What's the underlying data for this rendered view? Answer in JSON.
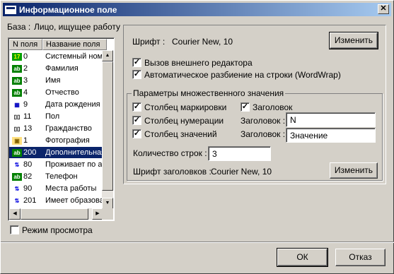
{
  "window": {
    "title": "Информационное поле",
    "close_glyph": "✕"
  },
  "base": {
    "label": "База :",
    "value": "Лицо, ищущее работу"
  },
  "fields_list": {
    "columns": [
      "N поля",
      "Название поля"
    ],
    "rows": [
      {
        "num": "0",
        "name": "Системный ном",
        "icon": "numeric-field-icon",
        "selected": false
      },
      {
        "num": "2",
        "name": "Фамилия",
        "icon": "text-field-icon",
        "selected": false
      },
      {
        "num": "3",
        "name": "Имя",
        "icon": "text-field-icon",
        "selected": false
      },
      {
        "num": "4",
        "name": "Отчество",
        "icon": "text-field-icon",
        "selected": false
      },
      {
        "num": "9",
        "name": "Дата рождения",
        "icon": "date-field-icon",
        "selected": false
      },
      {
        "num": "11",
        "name": "Пол",
        "icon": "dictionary-field-icon",
        "selected": false
      },
      {
        "num": "13",
        "name": "Гражданство",
        "icon": "dictionary-field-icon",
        "selected": false
      },
      {
        "num": "1",
        "name": "Фотография",
        "icon": "image-field-icon",
        "selected": false
      },
      {
        "num": "200",
        "name": "Дополнительная",
        "icon": "text-field-icon",
        "selected": true
      },
      {
        "num": "80",
        "name": "Проживает по а",
        "icon": "link-field-icon",
        "selected": false
      },
      {
        "num": "82",
        "name": "Телефон",
        "icon": "text-field-icon",
        "selected": false
      },
      {
        "num": "90",
        "name": "Места работы",
        "icon": "link-field-icon",
        "selected": false
      },
      {
        "num": "201",
        "name": "Имеет образова",
        "icon": "link-field-icon",
        "selected": false
      }
    ]
  },
  "view_mode": {
    "label": "Режим просмотра",
    "checked": false
  },
  "font": {
    "label": "Шрифт :",
    "value": "Courier New, 10",
    "change_button": "Изменить"
  },
  "external_editor": {
    "label": "Вызов внешнего редактора",
    "checked": true
  },
  "wordwrap": {
    "label": "Автоматическое разбиение на строки (WordWrap)",
    "checked": true
  },
  "multi": {
    "group_title": "Параметры множественного значения",
    "marker_column": {
      "label": "Столбец маркировки",
      "checked": true
    },
    "header": {
      "label": "Заголовок",
      "checked": true
    },
    "number_column": {
      "label": "Столбец нумерации",
      "checked": true
    },
    "number_header_label": "Заголовок :",
    "number_header_value": "N",
    "values_column": {
      "label": "Столбец значений",
      "checked": true
    },
    "values_header_label": "Заголовок :",
    "values_header_value": "Значение",
    "rows_count_label": "Количество строк :",
    "rows_count_value": "3",
    "header_font_label": "Шрифт заголовков :",
    "header_font_value": "Courier New, 10",
    "header_font_change_button": "Изменить"
  },
  "buttons": {
    "ok": "ОК",
    "cancel": "Отказ"
  },
  "colors": {
    "title_start": "#0a246a",
    "title_end": "#a6caf0",
    "selection": "#0a246a",
    "face": "#d4d0c8"
  }
}
